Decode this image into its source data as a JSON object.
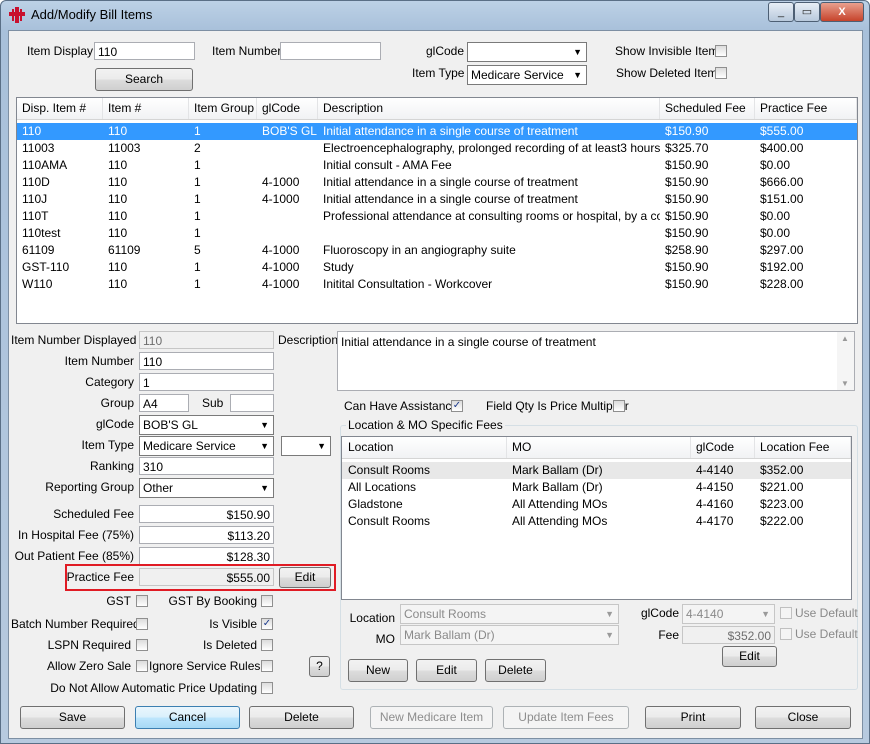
{
  "window": {
    "title": "Add/Modify Bill Items",
    "controls": [
      "_",
      "▭",
      "X"
    ]
  },
  "search": {
    "item_display_label": "Item Display",
    "item_display_value": "110",
    "item_number_label": "Item Number",
    "item_number_value": "",
    "glcode_label": "glCode",
    "glcode_value": "",
    "item_type_label": "Item Type",
    "item_type_value": "Medicare Service",
    "show_invisible_label": "Show Invisible Items",
    "show_deleted_label": "Show Deleted Items",
    "search_button": "Search"
  },
  "items_grid": {
    "columns": [
      "Disp. Item #",
      "Item #",
      "Item Group",
      "glCode",
      "Description",
      "Scheduled Fee",
      "Practice Fee"
    ],
    "rows": [
      [
        "110",
        "110",
        "1",
        "BOB'S GL",
        "Initial attendance in a single course of treatment",
        "$150.90",
        "$555.00"
      ],
      [
        "11003",
        "11003",
        "2",
        "",
        "Electroencephalography, prolonged recording of at least3 hours dur...",
        "$325.70",
        "$400.00"
      ],
      [
        "110AMA",
        "110",
        "1",
        "",
        "Initial consult - AMA Fee",
        "$150.90",
        "$0.00"
      ],
      [
        "110D",
        "110",
        "1",
        "4-1000",
        "Initial attendance in a single course of treatment",
        "$150.90",
        "$666.00"
      ],
      [
        "110J",
        "110",
        "1",
        "4-1000",
        "Initial attendance in a single course of treatment",
        "$150.90",
        "$151.00"
      ],
      [
        "110T",
        "110",
        "1",
        "",
        "Professional attendance at consulting rooms or hospital, by a consul...",
        "$150.90",
        "$0.00"
      ],
      [
        "110test",
        "110",
        "1",
        "",
        "",
        "$150.90",
        "$0.00"
      ],
      [
        "61109",
        "61109",
        "5",
        "4-1000",
        "Fluoroscopy in an angiography suite",
        "$258.90",
        "$297.00"
      ],
      [
        "GST-110",
        "110",
        "1",
        "4-1000",
        "Study",
        "$150.90",
        "$192.00"
      ],
      [
        "W110",
        "110",
        "1",
        "4-1000",
        "Initital Consultation - Workcover",
        "$150.90",
        "$228.00"
      ]
    ]
  },
  "detail": {
    "item_number_displayed_label": "Item Number Displayed",
    "item_number_displayed_value": "110",
    "item_number_label": "Item Number",
    "item_number_value": "110",
    "category_label": "Category",
    "category_value": "1",
    "group_label": "Group",
    "group_value": "A4",
    "sub_label": "Sub",
    "sub_value": "",
    "glcode_label": "glCode",
    "glcode_value": "BOB'S GL",
    "item_type_label": "Item Type",
    "item_type_value": "Medicare Service",
    "item_type_extra_value": "",
    "ranking_label": "Ranking",
    "ranking_value": "310",
    "reporting_group_label": "Reporting Group",
    "reporting_group_value": "Other",
    "scheduled_fee_label": "Scheduled Fee",
    "scheduled_fee_value": "$150.90",
    "in_hospital_fee_label": "In Hospital Fee (75%)",
    "in_hospital_fee_value": "$113.20",
    "out_patient_fee_label": "Out Patient Fee (85%)",
    "out_patient_fee_value": "$128.30",
    "practice_fee_label": "Practice Fee",
    "practice_fee_value": "$555.00",
    "edit_button": "Edit",
    "gst_label": "GST",
    "gst_by_booking_label": "GST By Booking",
    "batch_number_label": "Batch Number Required",
    "is_visible_label": "Is Visible",
    "lspn_label": "LSPN Required",
    "is_deleted_label": "Is Deleted",
    "allow_zero_label": "Allow Zero Sale",
    "ignore_rules_label": "Ignore Service Rules",
    "help_button": "?",
    "no_auto_price_label": "Do Not Allow Automatic Price Updating",
    "description_label": "Description",
    "description_value": "Initial attendance in a single course of treatment",
    "can_have_assistance_label": "Can Have Assistance",
    "field_qty_label": "Field Qty Is Price Multiplier"
  },
  "location_fees": {
    "title": "Location & MO Specific Fees",
    "columns": [
      "Location",
      "MO",
      "glCode",
      "Location Fee"
    ],
    "rows": [
      [
        "Consult Rooms",
        "Mark Ballam (Dr)",
        "4-4140",
        "$352.00"
      ],
      [
        "All Locations",
        "Mark Ballam (Dr)",
        "4-4150",
        "$221.00"
      ],
      [
        "Gladstone",
        "All Attending MOs",
        "4-4160",
        "$223.00"
      ],
      [
        "Consult Rooms",
        "All Attending MOs",
        "4-4170",
        "$222.00"
      ]
    ],
    "location_label": "Location",
    "location_value": "Consult Rooms",
    "mo_label": "MO",
    "mo_value": "Mark Ballam (Dr)",
    "glcode_label": "glCode",
    "glcode_value": "4-4140",
    "fee_label": "Fee",
    "fee_value": "$352.00",
    "use_default_label": "Use Default",
    "edit_button": "Edit",
    "new_button": "New",
    "edit2_button": "Edit",
    "delete_button": "Delete"
  },
  "footer": {
    "save": "Save",
    "cancel": "Cancel",
    "delete": "Delete",
    "new_medicare": "New Medicare Item",
    "update_fees": "Update Item Fees",
    "print": "Print",
    "close": "Close"
  },
  "colors": {
    "selection": "#3399ff",
    "highlight_box": "#e01b24",
    "title_gradient": "#a8c0da"
  }
}
